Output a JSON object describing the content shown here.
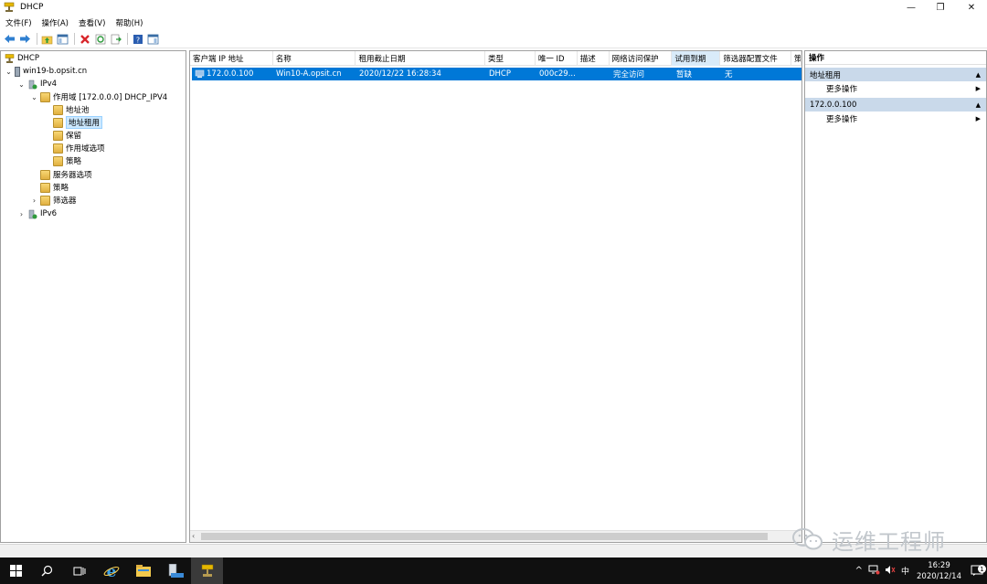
{
  "window": {
    "title": "DHCP",
    "controls": {
      "minimize": "—",
      "restore": "❐",
      "close": "✕"
    }
  },
  "menu": [
    "文件(F)",
    "操作(A)",
    "查看(V)",
    "帮助(H)"
  ],
  "toolbar": {
    "icons": [
      "back-icon",
      "forward-icon",
      "up-folder-icon",
      "show-hide-tree-icon",
      "delete-icon",
      "refresh-icon",
      "export-list-icon",
      "help-icon",
      "show-hide-action-pane-icon"
    ]
  },
  "tree": {
    "root": "DHCP",
    "server": "win19-b.opsit.cn",
    "ipv4": "IPv4",
    "scope": "作用域 [172.0.0.0] DHCP_IPV4",
    "address_pool": "地址池",
    "address_leases": "地址租用",
    "reservations": "保留",
    "scope_options": "作用域选项",
    "scope_policies": "策略",
    "server_options": "服务器选项",
    "policies": "策略",
    "filters": "筛选器",
    "ipv6": "IPv6"
  },
  "list": {
    "columns": [
      "客户端 IP 地址",
      "名称",
      "租用截止日期",
      "类型",
      "唯一 ID",
      "描述",
      "网络访问保护",
      "试用到期",
      "筛选器配置文件",
      "策"
    ],
    "rows": [
      {
        "ip": "172.0.0.100",
        "name": "Win10-A.opsit.cn",
        "expires": "2020/12/22 16:28:34",
        "type": "DHCP",
        "unique_id": "000c29...",
        "description": "",
        "nap": "完全访问",
        "probation": "暂缺",
        "filter_profile": "无"
      }
    ]
  },
  "actions": {
    "header": "操作",
    "sections": [
      {
        "title": "地址租用",
        "item": "更多操作"
      },
      {
        "title": "172.0.0.100",
        "item": "更多操作"
      }
    ]
  },
  "watermark": {
    "text": "运维工程师"
  },
  "taskbar": {
    "clock_time": "16:29",
    "clock_date": "2020/12/14",
    "ime": "中",
    "notification_count": "1"
  }
}
